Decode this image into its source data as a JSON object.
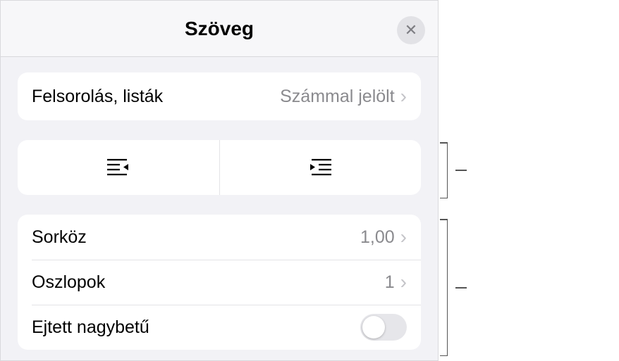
{
  "header": {
    "title": "Szöveg"
  },
  "bullets": {
    "label": "Felsorolás, listák",
    "value": "Számmal jelölt"
  },
  "spacing": {
    "lineSpacing": {
      "label": "Sorköz",
      "value": "1,00"
    },
    "columns": {
      "label": "Oszlopok",
      "value": "1"
    },
    "dropCap": {
      "label": "Ejtett nagybetű"
    }
  }
}
